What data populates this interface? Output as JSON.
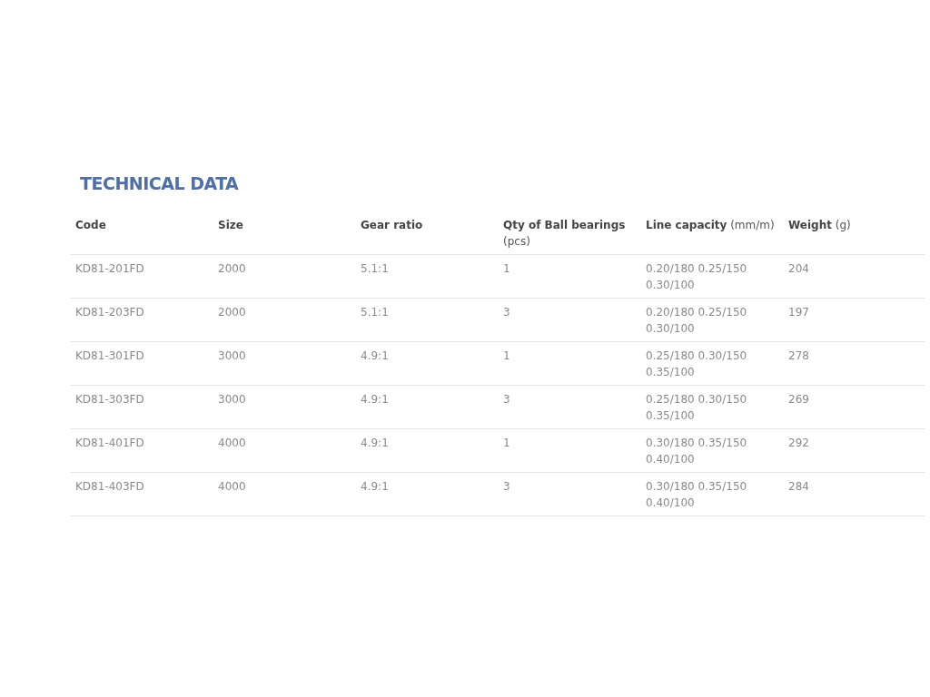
{
  "title": "TECHNICAL DATA",
  "table": {
    "columns": [
      "Code",
      "Size",
      "Gear ratio",
      "**Qty of Ball bearings** (pcs)",
      "**Line capacity** (mm/m)",
      "**Weight** (g)"
    ],
    "rows": [
      [
        "KD81-201FD",
        "2000",
        "5.1:1",
        "1",
        "0.20/180 0.25/150 0.30/100",
        "204"
      ],
      [
        "KD81-203FD",
        "2000",
        "5.1:1",
        "3",
        "0.20/180 0.25/150 0.30/100",
        "197"
      ],
      [
        "KD81-301FD",
        "3000",
        "4.9:1",
        "1",
        "0.25/180 0.30/150 0.35/100",
        "278"
      ],
      [
        "KD81-303FD",
        "3000",
        "4.9:1",
        "3",
        "0.25/180 0.30/150 0.35/100",
        "269"
      ],
      [
        "KD81-401FD",
        "4000",
        "4.9:1",
        "1",
        "0.30/180 0.35/150 0.40/100",
        "292"
      ],
      [
        "KD81-403FD",
        "4000",
        "4.9:1",
        "3",
        "0.30/180 0.35/150 0.40/100",
        "284"
      ]
    ]
  }
}
